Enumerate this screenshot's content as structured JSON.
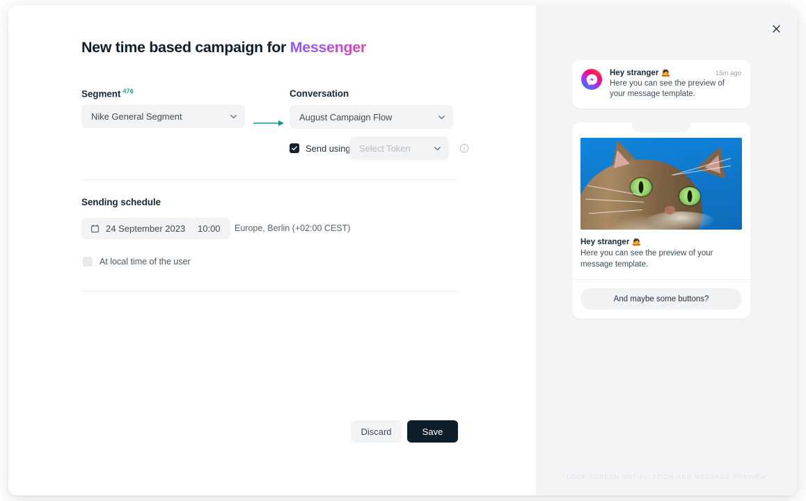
{
  "modal": {
    "title_prefix": "New time based campaign for ",
    "title_channel": "Messenger",
    "close_icon": "close-icon"
  },
  "form": {
    "segment": {
      "label": "Segment",
      "count": "476",
      "value": "Nike General Segment",
      "chevron_icon": "chevron-down-icon"
    },
    "connector_icon": "arrow-right-icon",
    "conversation": {
      "label": "Conversation",
      "value": "August Campaign Flow",
      "chevron_icon": "chevron-down-icon"
    },
    "send_using": {
      "checked": true,
      "label": "Send using",
      "token_placeholder": "Select Token",
      "chevron_icon": "chevron-down-icon",
      "info_icon": "info-icon",
      "check_icon": "check-icon"
    },
    "schedule": {
      "label": "Sending schedule",
      "calendar_icon": "calendar-icon",
      "date": "24 September 2023",
      "time": "10:00",
      "timezone": "Europe, Berlin (+02:00 CEST)",
      "local_time_label": "At local time of the user",
      "local_time_checked": false
    }
  },
  "footer": {
    "discard_label": "Discard",
    "save_label": "Save"
  },
  "preview": {
    "notification": {
      "logo_icon": "messenger-logo-icon",
      "title": "Hey stranger",
      "title_emoji": "🙇",
      "time": "15m ago",
      "text": "Here you can see the preview of your message template."
    },
    "message_card": {
      "image_alt": "cat-photo",
      "title": "Hey stranger",
      "title_emoji": "🙇",
      "body": "Here you can see the preview of your message template.",
      "button_label": "And maybe some buttons?"
    },
    "caption": "Lock screen notification and message preview"
  },
  "colors": {
    "accent_teal": "#18a08f",
    "save_dark": "#0e1f2b",
    "chip_gray": "#f2f3f5",
    "pane_gray": "#f3f4f6",
    "gradient_start": "#8b5cf6",
    "gradient_end": "#e048a8"
  }
}
